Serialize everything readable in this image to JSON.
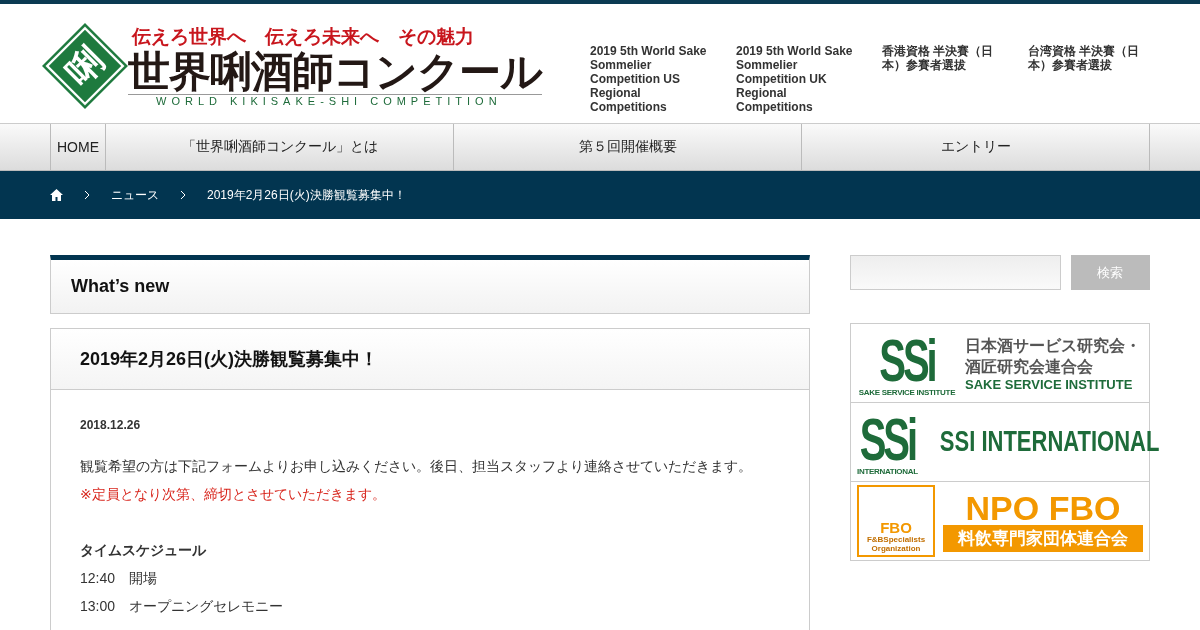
{
  "logo": {
    "tagline": "伝えろ世界へ　伝えろ未来へ　その魅力",
    "mark": "唎",
    "title": "世界唎酒師コンクール",
    "subtitle": "WORLD KIKISAKE-SHI COMPETITION"
  },
  "header_links": [
    "2019 5th World Sake Sommelier Competition US Regional Competitions",
    "2019 5th World Sake Sommelier Competition UK Regional Competitions",
    "香港資格 半決賽（日本）参賽者選拔",
    "台湾資格 半決賽（日本）参賽者選拔"
  ],
  "nav": [
    {
      "label": "HOME",
      "selected": false
    },
    {
      "label": "「世界唎酒師コンクール」とは",
      "selected": false
    },
    {
      "label": "第５回開催概要",
      "selected": false
    },
    {
      "label": "エントリー",
      "selected": false
    }
  ],
  "breadcrumb": [
    "ニュース",
    "2019年2月26日(火)決勝観覧募集中！"
  ],
  "section_title": "What’s new",
  "post": {
    "title": "2019年2月26日(火)決勝観覧募集中！",
    "date": "2018.12.26",
    "body": "観覧希望の方は下記フォームよりお申し込みください。後日、担当スタッフより連絡させていただきます。",
    "notice": "※定員となり次第、締切とさせていただきます。",
    "schedule_title": "タイムスケジュール",
    "schedule": [
      {
        "time": "12:40",
        "event": "開場"
      },
      {
        "time": "13:00",
        "event": "オープニングセレモニー"
      }
    ]
  },
  "search": {
    "button": "検索"
  },
  "banners": [
    {
      "kind": "ssi",
      "mark": "SSi",
      "mark_caption": "SAKE SERVICE INSTITUTE",
      "title_lines": [
        "日本酒サービス研究会・",
        "酒匠研究会連合会"
      ],
      "subtitle": "SAKE SERVICE INSTITUTE"
    },
    {
      "kind": "ssi_intl",
      "mark": "SSi",
      "mark_caption": "INTERNATIONAL",
      "title": "SSI INTERNATIONAL"
    },
    {
      "kind": "fbo",
      "mark": "FBO",
      "mark_caption": "F&BSpecialists Organization",
      "title": "NPO FBO",
      "subtitle": "料飲専門家団体連合会"
    }
  ]
}
